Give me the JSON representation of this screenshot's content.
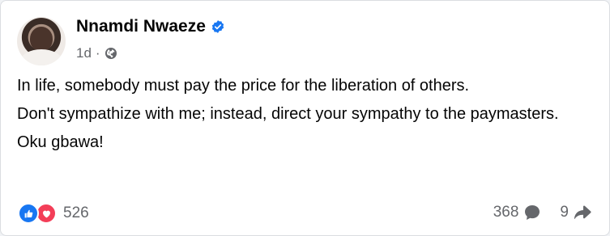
{
  "post": {
    "author": "Nnamdi Nwaeze",
    "verified": true,
    "time": "1d",
    "separator": "·",
    "audience_icon": "globe-icon",
    "paragraphs": [
      "In life, somebody must pay the price for the liberation of others.",
      "Don't sympathize with me; instead, direct your sympathy to the paymasters.",
      "Oku gbawa!"
    ]
  },
  "footer": {
    "reactions": [
      "like-icon",
      "love-icon"
    ],
    "reaction_count": "526",
    "comment_count": "368",
    "comment_icon": "comment-icon",
    "share_count": "9",
    "share_icon": "share-arrow-icon"
  },
  "colors": {
    "like": "#1877f2",
    "love": "#f33e58",
    "verified": "#1877f2",
    "meta": "#65676b",
    "text": "#050505"
  }
}
